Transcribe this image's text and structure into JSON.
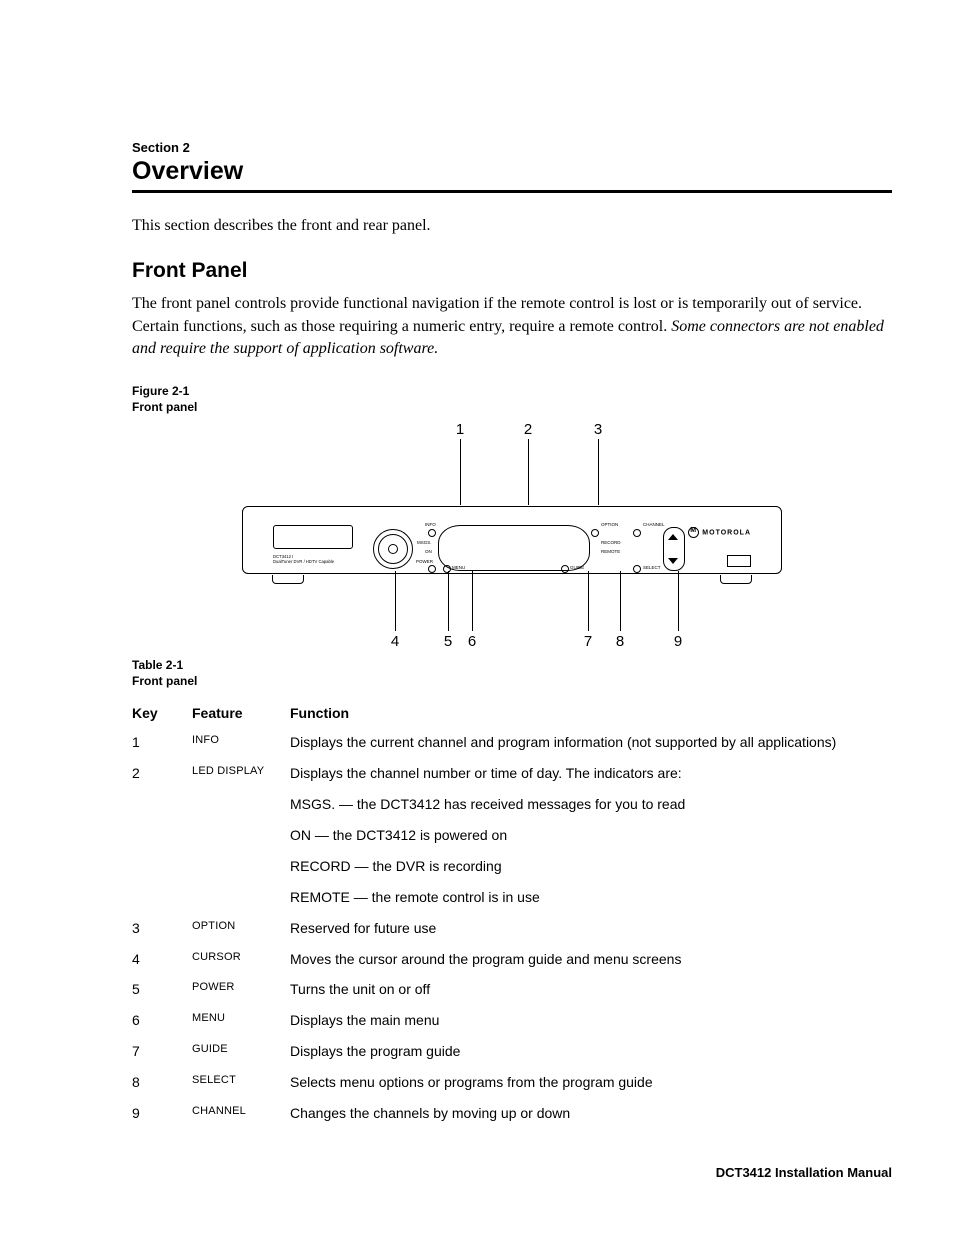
{
  "section_label": "Section 2",
  "section_title": "Overview",
  "intro": "This section describes the front and rear panel.",
  "subhead": "Front Panel",
  "front_panel_para_plain": "The front panel controls provide functional navigation if the remote control is lost or is temporarily out of service. Certain functions, such as those requiring a numeric entry, require a remote control. ",
  "front_panel_para_italic": "Some connectors are not enabled and require the support of application software.",
  "figure_label_line1": "Figure 2-1",
  "figure_label_line2": "Front panel",
  "table_label_line1": "Table 2-1",
  "table_label_line2": "Front panel",
  "callouts_top": [
    "1",
    "2",
    "3"
  ],
  "callouts_bottom": [
    "4",
    "5",
    "6",
    "7",
    "8",
    "9"
  ],
  "device": {
    "brand": "MOTOROLA",
    "model_line1": "DCT3412 I",
    "model_line2": "DualTuner DVR / HDTV Capable",
    "btn_info": "INFO",
    "btn_option": "OPTION",
    "btn_power": "POWER",
    "btn_menu": "MENU",
    "btn_guide": "GUIDE",
    "btn_select": "SELECT",
    "btn_channel": "CHANNEL",
    "ind_msgs": "MSGS.",
    "ind_on": "ON",
    "ind_record": "RECORD",
    "ind_remote": "REMOTE"
  },
  "table": {
    "headers": {
      "key": "Key",
      "feature": "Feature",
      "function": "Function"
    },
    "rows": [
      {
        "key": "1",
        "feature": "INFO",
        "func": "Displays the current channel and program information (not supported by all applications)"
      },
      {
        "key": "2",
        "feature": "LED DISPLAY",
        "func": "Displays the channel number or time of day. The indicators are:",
        "sub": [
          "MSGS. — the DCT3412 has received messages for you to read",
          "ON — the DCT3412 is powered on",
          "RECORD — the DVR is recording",
          "REMOTE — the remote control is in use"
        ]
      },
      {
        "key": "3",
        "feature": "OPTION",
        "func": "Reserved for future use"
      },
      {
        "key": "4",
        "feature": "CURSOR",
        "func": "Moves the cursor around the program guide and menu screens"
      },
      {
        "key": "5",
        "feature": "POWER",
        "func": "Turns the unit on or off"
      },
      {
        "key": "6",
        "feature": "MENU",
        "func": "Displays the main menu"
      },
      {
        "key": "7",
        "feature": "GUIDE",
        "func": "Displays the program guide"
      },
      {
        "key": "8",
        "feature": "SELECT",
        "func": "Selects menu options or programs from the program guide"
      },
      {
        "key": "9",
        "feature": "CHANNEL",
        "func": "Changes the channels by moving up or down"
      }
    ]
  },
  "footer": "DCT3412 Installation Manual"
}
